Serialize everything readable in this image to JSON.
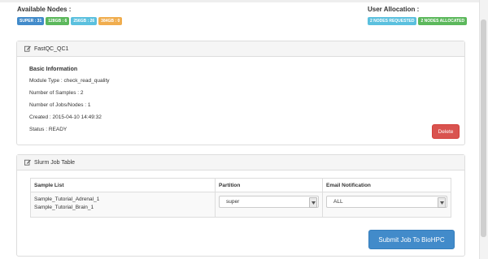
{
  "available_nodes": {
    "title": "Available Nodes :",
    "badges": [
      {
        "label": "SUPER : 31",
        "color": "#428bca"
      },
      {
        "label": "128GB : 6",
        "color": "#5cb85c"
      },
      {
        "label": "256GB : 26",
        "color": "#5bc0de"
      },
      {
        "label": "384GB : 0",
        "color": "#f0ad4e"
      }
    ]
  },
  "user_allocation": {
    "title": "User Allocation :",
    "badges": [
      {
        "label": "2 NODES REQUESTED",
        "color": "#5bc0de"
      },
      {
        "label": "2 NODES ALLOCATED",
        "color": "#5cb85c"
      }
    ]
  },
  "module_panel": {
    "title": "FastQC_QC1",
    "info_title": "Basic Information",
    "lines": [
      "Module Type : check_read_quality",
      "Number of Samples : 2",
      "Number of Jobs/Nodes : 1",
      "Created : 2015-04-10 14:49:32",
      "Status : READY"
    ],
    "delete_label": "Delete"
  },
  "job_panel": {
    "title": "Slurm Job Table",
    "columns": [
      "Sample List",
      "Partition",
      "Email Notification"
    ],
    "rows": [
      {
        "samples": [
          "Sample_Tutorial_Adrenal_1",
          "Sample_Tutorial_Brain_1"
        ],
        "partition": "super",
        "email": "ALL"
      }
    ],
    "submit_label": "Submit Job To BioHPC"
  }
}
